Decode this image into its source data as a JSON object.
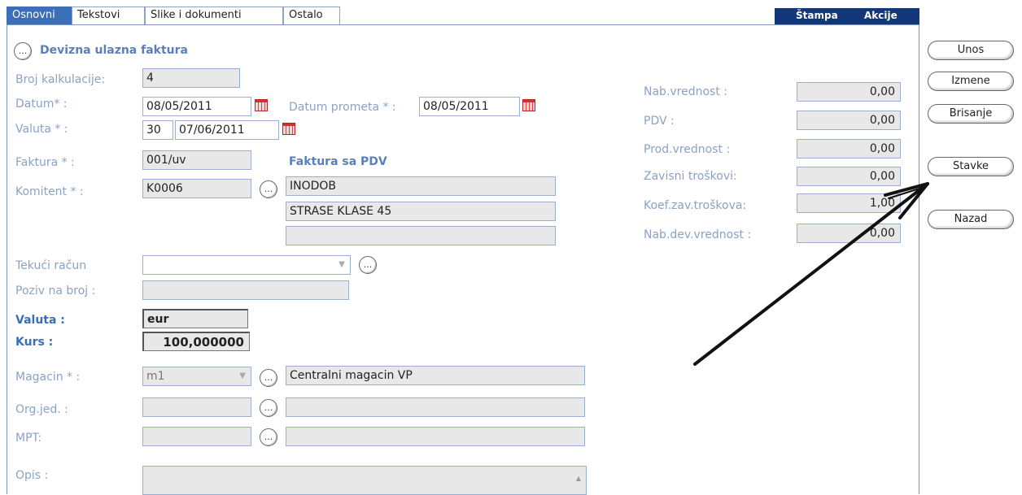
{
  "tabs": [
    "Osnovni",
    "Tekstovi",
    "Slike i dokumenti",
    "Ostalo"
  ],
  "actions": {
    "print": "Štampa",
    "actions": "Akcije"
  },
  "form": {
    "title": "Devizna ulazna faktura",
    "broj_kalkulacije": {
      "label": "Broj kalkulacije:",
      "value": "4"
    },
    "datum": {
      "label": "Datum* :",
      "value": "08/05/2011"
    },
    "datum_prometa": {
      "label": "Datum prometa * :",
      "value": "08/05/2011"
    },
    "valuta": {
      "label": "Valuta * :",
      "days": "30",
      "value": "07/06/2011"
    },
    "faktura": {
      "label": "Faktura * :",
      "value": "001/uv",
      "note": "Faktura sa PDV"
    },
    "komitent": {
      "label": "Komitent * :",
      "code": "K0006",
      "name": "INODOB",
      "address": "STRASE KLASE 45",
      "extra": ""
    },
    "tekuci_racun": {
      "label": "Tekući račun",
      "value": ""
    },
    "poziv_na_broj": {
      "label": "Poziv na broj :",
      "value": ""
    },
    "valuta_code": {
      "label": "Valuta :",
      "value": "eur"
    },
    "kurs": {
      "label": "Kurs :",
      "value": "100,000000"
    },
    "magacin": {
      "label": "Magacin * :",
      "code": "m1",
      "name": "Centralni magacin VP"
    },
    "org_jed": {
      "label": "Org.jed. :",
      "code": "",
      "name": ""
    },
    "mpt": {
      "label": "MPT:",
      "code": "",
      "name": ""
    },
    "opis": {
      "label": "Opis :",
      "value": ""
    }
  },
  "totals": [
    {
      "label": "Nab.vrednost :",
      "value": "0,00"
    },
    {
      "label": "PDV :",
      "value": "0,00"
    },
    {
      "label": "Prod.vrednost :",
      "value": "0,00"
    },
    {
      "label": "Zavisni troškovi:",
      "value": "0,00"
    },
    {
      "label": "Koef.zav.troškova:",
      "value": "1,00"
    },
    {
      "label": "Nab.dev.vrednost :",
      "value": "0,00"
    }
  ],
  "side_buttons": {
    "unos": "Unos",
    "izmene": "Izmene",
    "brisanje": "Brisanje",
    "stavke": "Stavke",
    "nazad": "Nazad"
  },
  "icons": {
    "ellipsis": "ellipsis-button-icon",
    "calendar": "calendar-icon",
    "arrow": "arrow-annotation-icon"
  },
  "ellipsis_glyph": "..."
}
